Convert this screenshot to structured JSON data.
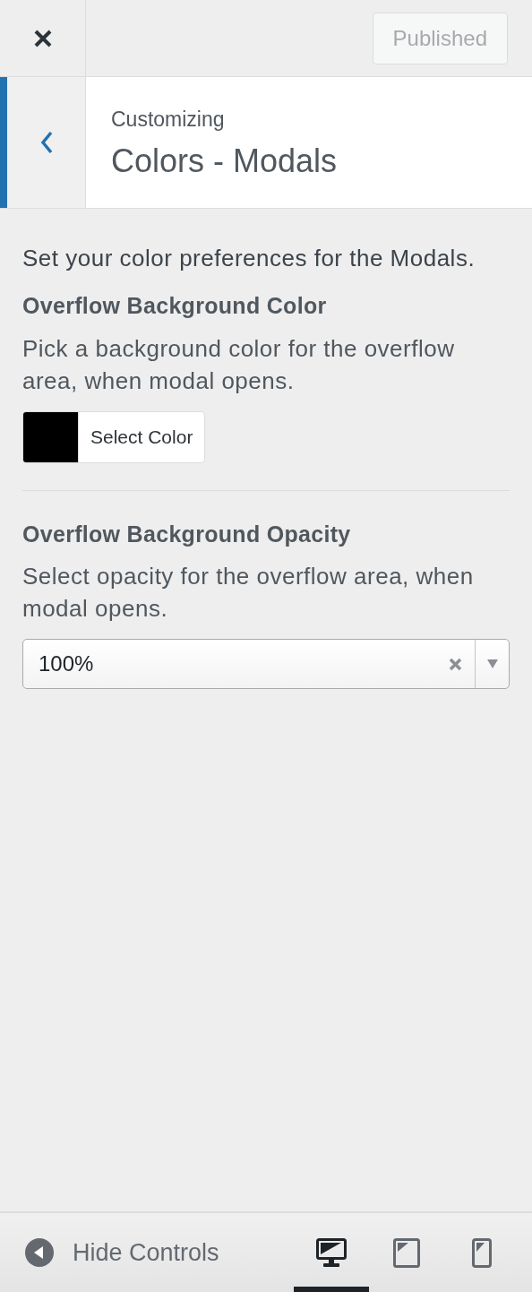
{
  "header": {
    "publish_button": {
      "label": "Published",
      "disabled": true
    }
  },
  "section": {
    "breadcrumb": "Customizing",
    "title": "Colors - Modals"
  },
  "description": "Set your color preferences for the Modals.",
  "controls": [
    {
      "kind": "color",
      "label": "Overflow Background Color",
      "description": "Pick a background color for the overflow area, when modal opens.",
      "color": "#000000",
      "button": "Select Color"
    },
    {
      "kind": "select",
      "label": "Overflow Background Opacity",
      "description": "Select opacity for the overflow area, when modal opens.",
      "value": "100%"
    }
  ],
  "footer": {
    "hide_controls": "Hide Controls",
    "devices": [
      {
        "kind": "desktop",
        "selected": true
      },
      {
        "kind": "tablet",
        "selected": false
      },
      {
        "kind": "mobile",
        "selected": false
      }
    ]
  }
}
